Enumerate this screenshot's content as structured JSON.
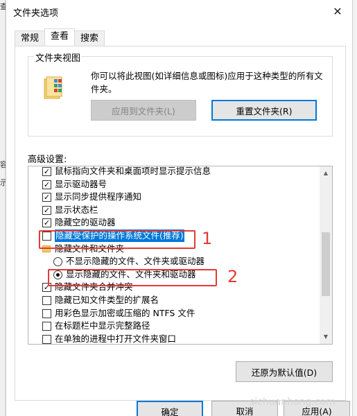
{
  "background": {
    "glyphs": [
      "查",
      "容",
      "示"
    ]
  },
  "dialog": {
    "title": "文件夹选项",
    "close_symbol": "✕"
  },
  "tabs": [
    {
      "label": "常规",
      "active": false
    },
    {
      "label": "查看",
      "active": true
    },
    {
      "label": "搜索",
      "active": false
    }
  ],
  "folder_views": {
    "legend": "文件夹视图",
    "icon": "folder-view-icon",
    "description": "你可以将此视图(如详细信息或图标)应用于这种类型的所有文件夹。",
    "apply_button": "应用到文件夹(L)",
    "reset_button": "重置文件夹(R)"
  },
  "advanced": {
    "label": "高级设置:",
    "items": [
      {
        "type": "checkbox",
        "checked": true,
        "label": "鼠标指向文件夹和桌面项时显示提示信息",
        "indent": 0
      },
      {
        "type": "checkbox",
        "checked": true,
        "label": "显示驱动器号",
        "indent": 0
      },
      {
        "type": "checkbox",
        "checked": true,
        "label": "显示同步提供程序通知",
        "indent": 0
      },
      {
        "type": "checkbox",
        "checked": true,
        "label": "显示状态栏",
        "indent": 0
      },
      {
        "type": "checkbox",
        "checked": true,
        "label": "隐藏空的驱动器",
        "indent": 0
      },
      {
        "type": "checkbox",
        "checked": false,
        "label": "隐藏受保护的操作系统文件(推荐)",
        "indent": 0,
        "highlighted": true
      },
      {
        "type": "folder",
        "label": "隐藏文件和文件夹",
        "indent": 0
      },
      {
        "type": "radio",
        "checked": false,
        "label": "不显示隐藏的文件、文件夹或驱动器",
        "indent": 1
      },
      {
        "type": "radio",
        "checked": true,
        "label": "显示隐藏的文件、文件夹和驱动器",
        "indent": 1
      },
      {
        "type": "checkbox",
        "checked": true,
        "label": "隐藏文件夹合并冲突",
        "indent": 0
      },
      {
        "type": "checkbox",
        "checked": false,
        "label": "隐藏已知文件类型的扩展名",
        "indent": 0
      },
      {
        "type": "checkbox",
        "checked": false,
        "label": "用彩色显示加密或压缩的 NTFS 文件",
        "indent": 0
      },
      {
        "type": "checkbox",
        "checked": false,
        "label": "在标题栏中显示完整路径",
        "indent": 0
      },
      {
        "type": "checkbox",
        "checked": false,
        "label": "在单独的进程中打开文件夹窗口",
        "indent": 0
      }
    ],
    "scroll_up": "▲",
    "scroll_down": "▼"
  },
  "restore_button": "还原为默认值(D)",
  "footer": {
    "ok": "确定",
    "cancel": "取消",
    "apply": "应用(A)"
  },
  "annotations": {
    "num1": "1",
    "num2": "2",
    "color": "#e53935"
  },
  "watermark": "sichuanhong.com",
  "colors": {
    "accent": "#0078d7"
  }
}
